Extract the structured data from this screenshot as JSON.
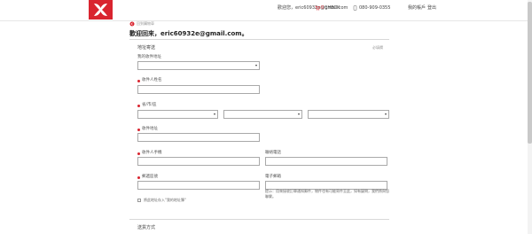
{
  "brand": {
    "logo": "under-armour-logo",
    "color": "#d9242f"
  },
  "header": {
    "user_text": "歡迎您，eric60932e@gmail.com",
    "cart_text": "0",
    "cart_suffix": "CHECK",
    "phone_text": "080-909-0355",
    "account_link": "我的帳戶",
    "logout_link": "登出"
  },
  "page": {
    "back_link": "回到購物車",
    "welcome": "歡迎回來，eric60932e@gmail.com。",
    "section_title": "地址寄送",
    "required_note": "必填欄",
    "my_addresses_label": "我的收件地址",
    "fields": {
      "name_label": "收件人姓名",
      "city_label": "省/市/區",
      "address_label": "收件地址",
      "mobile_label": "收件人手機",
      "landline_label": "聯絡電話",
      "zip_label": "郵遞區號",
      "email_label": "電子郵箱"
    },
    "hint": "提示：用來接收訂單通知郵件，物件也有可能寄件至此，如有疑問，我們將與您聯繫。",
    "save_checkbox_label": "將此地址存入\"我的地址簿\"",
    "next_section": "送貨方式"
  }
}
